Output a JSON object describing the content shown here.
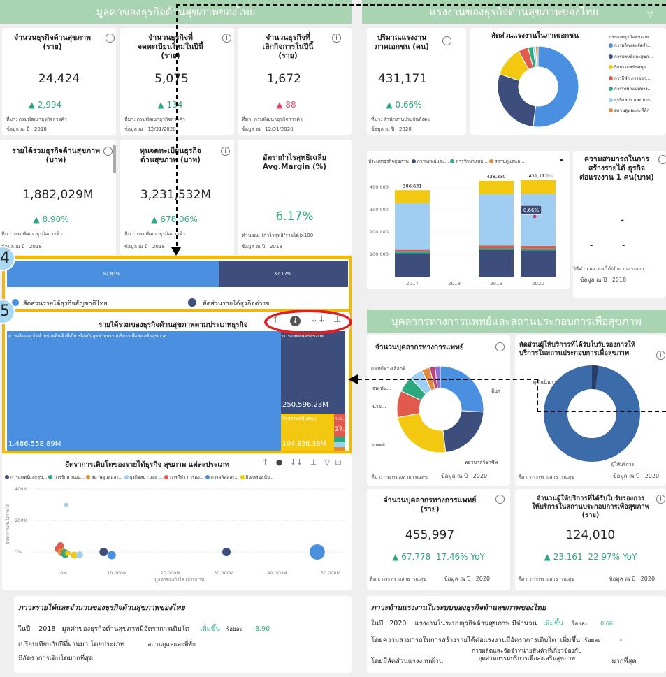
{
  "left_banner": "มูลค่าของธุรกิจด้านสุขภาพของไทย",
  "right_banner": "แรงงานของธุรกิจด้านสุขภาพของไทย",
  "medical_banner": "บุคลากรทางการแพทย์และสถานประกอบการเพื่อสุขภาพ",
  "kpi": {
    "k1": {
      "title": "จำนวนธุรกิจด้านสุขภาพ\n(ราย)",
      "value": "24,424",
      "delta": "▲ 2,994",
      "src": "ที่มา: กรมพัฒนาธุรกิจการค้า",
      "date_label": "ข้อมูล ณ ปี",
      "date": "2018"
    },
    "k2": {
      "title": "จำนวนธุรกิจที่\nจดทะเบียนใหม่ในปีนี้\n(ราย)",
      "value": "5,075",
      "delta": "▲ 134",
      "src": "ที่มา: กรมพัฒนาธุรกิจการค้า",
      "date_label": "ข้อมูล ณ",
      "date": "12/31/2020"
    },
    "k3": {
      "title": "จำนวนธุรกิจที่\nเลิกกิจการในปีนี้\n(ราย)",
      "value": "1,672",
      "delta": "▲ 88",
      "src": "ที่มา: กรมพัฒนาธุรกิจการค้า",
      "date_label": "ข้อมูล ณ",
      "date": "12/31/2020"
    },
    "k4": {
      "title": "รายได้รวมธุรกิจด้านสุขภาพ\n(บาท)",
      "value": "1,882,029M",
      "delta": "▲ 8.90%",
      "src": "ที่มา: กรมพัฒนาธุรกิจการค้า",
      "date_label": "ข้อมูล ณ ปี",
      "date": "2018"
    },
    "k5": {
      "title": "ทุนจดทะเบียนธุรกิจ\nด้านสุขภาพ (บาท)",
      "value": "3,231,532M",
      "delta": "▲ 678.06%",
      "src": "ที่มา: กรมพัฒนาธุรกิจการค้า",
      "date_label": "ข้อมูล ณ ปี",
      "date": "2018"
    },
    "k6": {
      "title": "อัตรากำไรสุทธิเฉลี่ย\nAvg.Margin (%)",
      "value": "6.17%",
      "src": "คำนวณ: (กำไรสุทธิ/รายได้)x100",
      "date_label": "ข้อมูล ณ ปี",
      "date": "2018"
    },
    "labor": {
      "title": "ปริมาณแรงงาน\nภาคเอกชน (คน)",
      "value": "431,171",
      "delta": "▲ 0.66%",
      "src": "ที่มา: สำนักงานประกันสังคม",
      "date_label": "ข้อมูล ณ ปี",
      "date": "2020"
    },
    "capacity": {
      "title": "ความสามารถในการ\nสร้างรายได้ ธุรกิจ\nต่อแรงงาน 1 คน(บาท)",
      "value": "-",
      "src": "วิธีคำนวณ รายได้/จำนวนแรงงาน",
      "date_label": "ข้อมูล ณ ปี",
      "date": "2018"
    }
  },
  "labor_donut": {
    "title": "สัดส่วนแรงงานในภาคเอกชน",
    "legend_title": "ประเภทธุรกิจสุขภาพ",
    "legend": [
      "การผลิตและจัดจำ...",
      "การแพทย์และสุขภ...",
      "กิจกรรมสนับสนุน",
      "การกีฬา การออก...",
      "การรักษาแบบทาง...",
      "ธุรกิจสปา และ การ...",
      "สถานดูแลและที่พัก"
    ],
    "colors": [
      "#4a8fe0",
      "#3d4e7c",
      "#f2c811",
      "#e05a4d",
      "#2ea87e",
      "#a0cdf2",
      "#e08a3a"
    ]
  },
  "labor_bar": {
    "legend_prefix": "ประเภทธุรกิจสุขภาพ",
    "legend": [
      "การแพทย์และ...",
      "การรักษาแบบ...",
      "สถานดูแลแล..."
    ],
    "years": [
      "2017",
      "2018",
      "2019",
      "2020"
    ],
    "totals": [
      "386,631",
      "",
      "428,330",
      "431,171"
    ],
    "yticks": [
      "400,000",
      "300,000",
      "200,000",
      "100,000"
    ],
    "y2ticks": [
      "0.8%",
      "0.7%",
      "0.6%",
      "0.5%"
    ],
    "badge": "0.66%"
  },
  "capacity_dashes": [
    "-",
    "-",
    "-"
  ],
  "share_bar": {
    "left_pct": "62.83%",
    "right_pct": "37.17%",
    "legend_left": "สัดส่วนรายได้ธุรกิจสัญชาติไทย",
    "legend_right": "สัดส่วนรายได้ธุรกิจต่างชาติ"
  },
  "callout_4": "4",
  "callout_5": "5",
  "treemap": {
    "title": "รายได้รวมของธุรกิจด้านสุขภาพตามประเภทธุรกิจ",
    "main_label": "การผลิตและจัดจำหน่ายสินค้าที่เกี่ยวข้องกับอุตสาหกรรมบริการเพื่อส่งเสริมสุขภาพ",
    "main_value": "1,486,558.89M",
    "med_label": "การแพทย์และสุขภาพ",
    "med_value": "250,596.23M",
    "support_label": "กิจกรรมสนับสนุน",
    "support_value": "104,836.38M",
    "small_label": "การ...",
    "small_value": "27..."
  },
  "scatter": {
    "title": "อัตราการเติบโตของรายได้ธุรกิจ สุขภาพ แต่ละประเภท",
    "legend": [
      "การแพทย์และสุข...",
      "การรักษาแบบ...",
      "สถานดูแลและ...",
      "ธุรกิจสปา และ ...",
      "การกีฬา การออ...",
      "การผลิตและ...",
      "กิจกรรมสนับ..."
    ],
    "colors": [
      "#3d4e7c",
      "#2ea87e",
      "#e08a3a",
      "#a0cdf2",
      "#e05a4d",
      "#4a8fe0",
      "#f2c811"
    ],
    "yticks": [
      "400%",
      "200%",
      "0%"
    ],
    "xticks": [
      "0M",
      "10,000M",
      "20,000M",
      "30,000M",
      "40,000M",
      "50,000M"
    ],
    "xlabel": "มูลค่าของกำไร (ล้านบาท)",
    "ylabel": "อัตราการเติบโตรายได้"
  },
  "medical_staff": {
    "title": "จำนวนบุคลากรทางการแพทย์",
    "labels": [
      "แพทย์ทางเลือกที่...",
      "จพ.ทัน...",
      "นาย...",
      "แพทย์",
      "อื่นๆ",
      "พยาบาลวิชาชีพ"
    ],
    "src": "ที่มา: กระทรวงสาธารณสุข",
    "date_label": "ข้อมูล ณ ปี",
    "date": "2020"
  },
  "service_share": {
    "title": "สัดส่วนผู้ให้บริการที่ได้รับใบรับรองการให้\nบริการในสถานประกอบการเพื่อสุขภาพ",
    "label_top": "ผู้ดำเนินการ",
    "label_bottom": "ผู้ให้บริการ",
    "src": "ที่มา: กระทรวงสาธารณสุข",
    "date_label": "ข้อมูล ณ ปี",
    "date": "2020"
  },
  "staff_kpi": {
    "title": "จำนวนบุคลากรทางการแพทย์\n(ราย)",
    "value": "455,997",
    "delta": "▲ 67,778  17.46% YoY",
    "src": "ที่มา: กระทรวงสาธารณสุข",
    "date_label": "ข้อมูล ณ ปี",
    "date": "2020"
  },
  "provider_kpi": {
    "title": "จำนวนผู้ให้บริการที่ได้รับใบรับรองการ\nให้บริการในสถานประกอบการเพื่อสุขภาพ\n(ราย)",
    "value": "124,010",
    "delta": "▲ 23,161  22.97% YoY",
    "src": "ที่มา: กระทรวงสาธารณสุข",
    "date_label": "ข้อมูล ณ ปี",
    "date": "2020"
  },
  "income_summary": {
    "title": "ภาวะรายได้และจำนวนของธุรกิจด้านสุขภาพของไทย",
    "l1a": "ในปี",
    "l1b": "2018",
    "l1c": "มูลค่าของธุรกิจด้านสุขภาพมีอัตราการเติบโต",
    "l1d": "เพิ่มขึ้น",
    "l1e": "ร้อยละ",
    "l1f": "8.90",
    "l2a": "เปรียบเทียบกับปีที่ผ่านมา โดยประเภท",
    "l2b": "สถานดูแลและที่พัก",
    "l3": "มีอัตราการเติบโตมากที่สุด"
  },
  "labor_summary": {
    "title": "ภาวะด้านแรงงานในระบบของธุรกิจด้านสุขภาพของไทย",
    "l1a": "ในปี",
    "l1b": "2020",
    "l1c": "แรงงานในระบบธุรกิจด้านสุขภาพ มีจำนวน",
    "l1d": "เพิ่มขึ้น",
    "l1e": "ร้อยละ",
    "l1f": "0.66",
    "l2a": "โดยความสามารถในการสร้างรายได้ต่อแรงงานมีอัตราการเติบโต",
    "l2b": "เพิ่มขึ้น",
    "l2c": "ร้อยละ",
    "l2d": "-",
    "l3a": "โดยมีสัดส่วนแรงงานด้าน",
    "l3b": "การผลิตและจัดจำหน่ายสินค้าที่เกี่ยวข้องกับ\nอุตสาหกรรมบริการเพื่อส่งเสริมสุขภาพ",
    "l3c": "มากที่สุด"
  }
}
